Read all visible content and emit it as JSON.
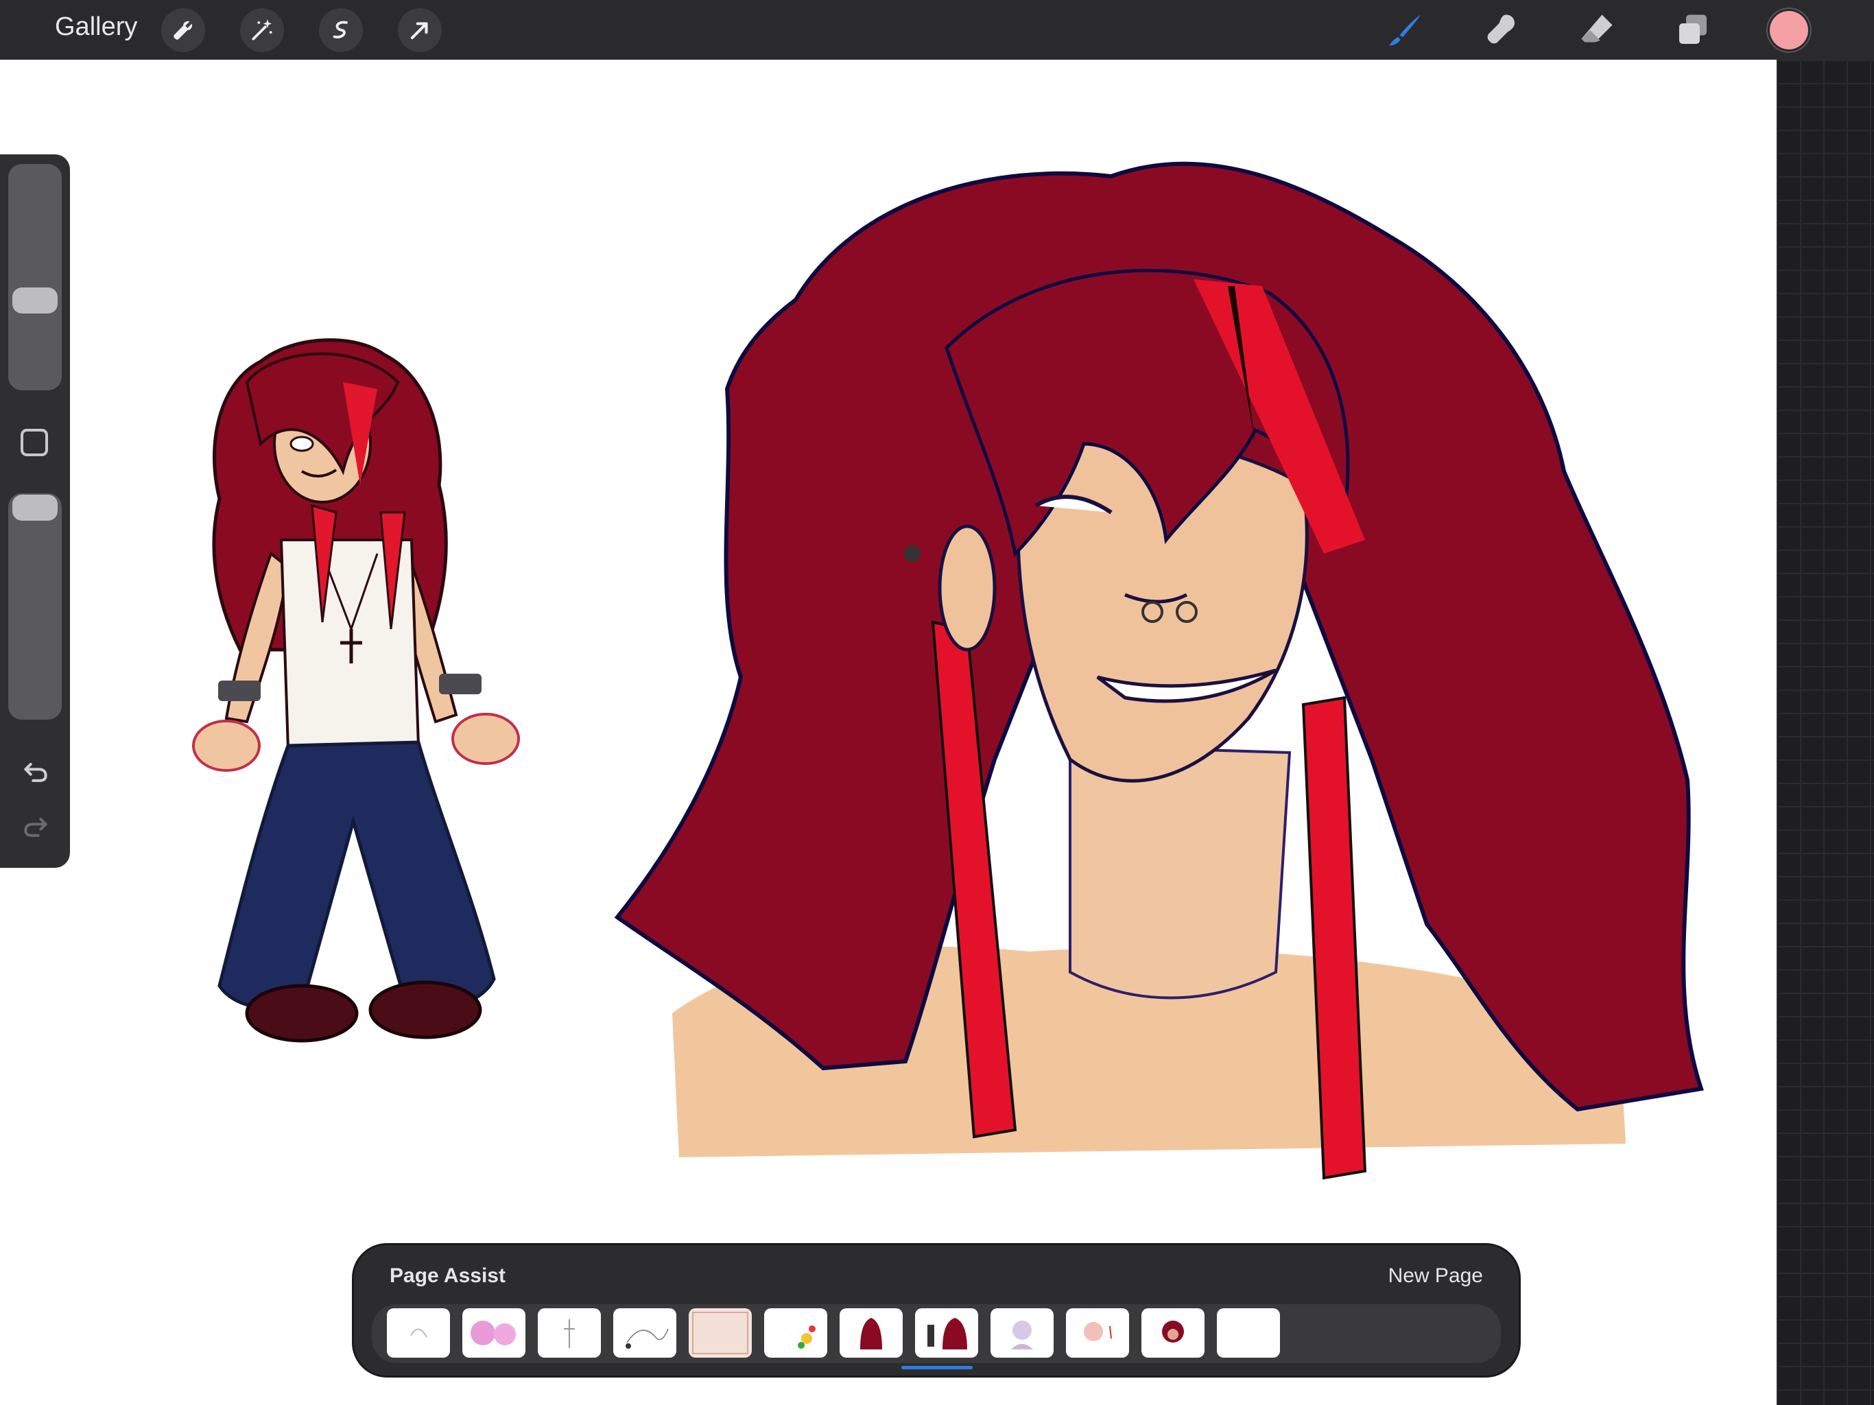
{
  "topbar": {
    "gallery_label": "Gallery",
    "left_tools": [
      "wrench-icon",
      "magic-wand-icon",
      "selection-icon",
      "transform-arrow-icon"
    ],
    "right_tools": [
      "brush-icon",
      "smudge-icon",
      "eraser-icon",
      "layers-icon"
    ],
    "active_tool": "brush-icon",
    "current_color": "#f4a0a4",
    "accent_color": "#2f7de1"
  },
  "sidebar": {
    "controls": [
      "brush-size-slider",
      "modify-button",
      "opacity-slider",
      "undo-icon",
      "redo-icon"
    ]
  },
  "page_assist": {
    "title": "Page Assist",
    "new_page_label": "New Page",
    "page_count": 12,
    "selected_page": 8
  }
}
